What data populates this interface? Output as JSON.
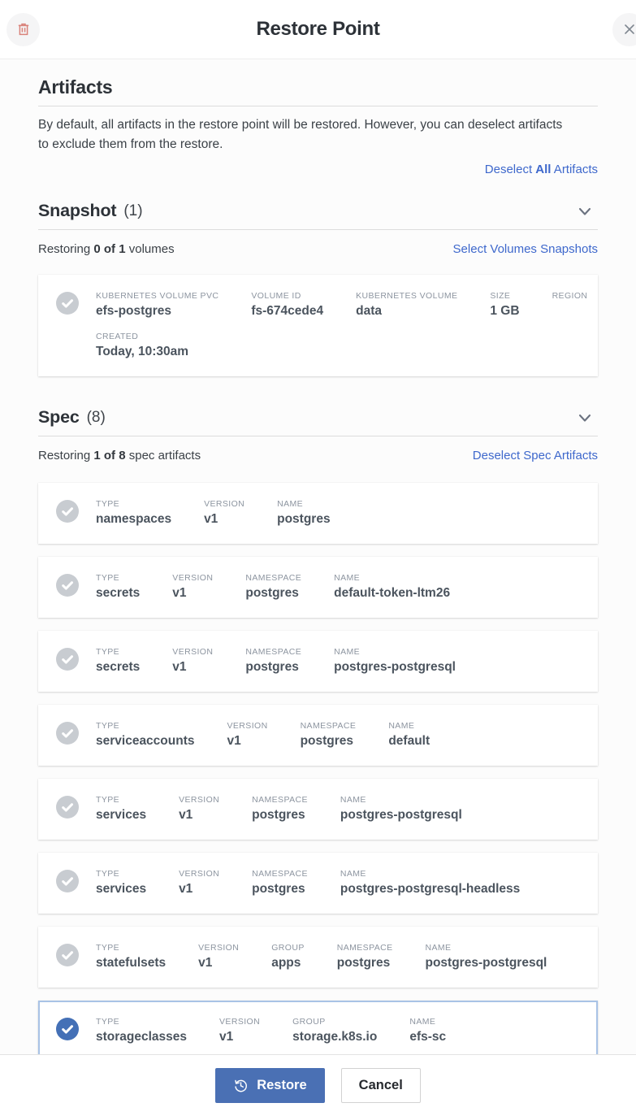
{
  "header": {
    "title": "Restore Point"
  },
  "artifacts": {
    "heading": "Artifacts",
    "description": "By default, all artifacts in the restore point will be restored. However, you can deselect artifacts to exclude them from the restore.",
    "deselect_link": {
      "pre": "Deselect ",
      "bold": "All",
      "post": " Artifacts"
    }
  },
  "snapshot": {
    "heading": "Snapshot",
    "count": "(1)",
    "restoring": {
      "pre": "Restoring ",
      "bold": "0 of 1",
      "post": " volumes"
    },
    "action_link": "Select Volumes Snapshots",
    "card": {
      "selected": false,
      "rows": [
        [
          {
            "label": "KUBERNETES VOLUME PVC",
            "value": "efs-postgres"
          },
          {
            "label": "VOLUME ID",
            "value": "fs-674cede4"
          },
          {
            "label": "KUBERNETES VOLUME",
            "value": "data"
          },
          {
            "label": "SIZE",
            "value": "1 GB"
          },
          {
            "label": "REGION",
            "value": ""
          }
        ],
        [
          {
            "label": "CREATED",
            "value": "Today, 10:30am"
          }
        ]
      ]
    }
  },
  "spec": {
    "heading": "Spec",
    "count": "(8)",
    "restoring": {
      "pre": "Restoring ",
      "bold": "1 of 8",
      "post": " spec artifacts"
    },
    "action_link": "Deselect Spec Artifacts",
    "cards": [
      {
        "selected": false,
        "fields": [
          {
            "label": "TYPE",
            "value": "namespaces"
          },
          {
            "label": "VERSION",
            "value": "v1"
          },
          {
            "label": "NAME",
            "value": "postgres"
          }
        ]
      },
      {
        "selected": false,
        "fields": [
          {
            "label": "TYPE",
            "value": "secrets"
          },
          {
            "label": "VERSION",
            "value": "v1"
          },
          {
            "label": "NAMESPACE",
            "value": "postgres"
          },
          {
            "label": "NAME",
            "value": "default-token-ltm26"
          }
        ]
      },
      {
        "selected": false,
        "fields": [
          {
            "label": "TYPE",
            "value": "secrets"
          },
          {
            "label": "VERSION",
            "value": "v1"
          },
          {
            "label": "NAMESPACE",
            "value": "postgres"
          },
          {
            "label": "NAME",
            "value": "postgres-postgresql"
          }
        ]
      },
      {
        "selected": false,
        "fields": [
          {
            "label": "TYPE",
            "value": "serviceaccounts"
          },
          {
            "label": "VERSION",
            "value": "v1"
          },
          {
            "label": "NAMESPACE",
            "value": "postgres"
          },
          {
            "label": "NAME",
            "value": "default"
          }
        ]
      },
      {
        "selected": false,
        "fields": [
          {
            "label": "TYPE",
            "value": "services"
          },
          {
            "label": "VERSION",
            "value": "v1"
          },
          {
            "label": "NAMESPACE",
            "value": "postgres"
          },
          {
            "label": "NAME",
            "value": "postgres-postgresql"
          }
        ]
      },
      {
        "selected": false,
        "fields": [
          {
            "label": "TYPE",
            "value": "services"
          },
          {
            "label": "VERSION",
            "value": "v1"
          },
          {
            "label": "NAMESPACE",
            "value": "postgres"
          },
          {
            "label": "NAME",
            "value": "postgres-postgresql-headless"
          }
        ]
      },
      {
        "selected": false,
        "fields": [
          {
            "label": "TYPE",
            "value": "statefulsets"
          },
          {
            "label": "VERSION",
            "value": "v1"
          },
          {
            "label": "GROUP",
            "value": "apps"
          },
          {
            "label": "NAMESPACE",
            "value": "postgres"
          },
          {
            "label": "NAME",
            "value": "postgres-postgresql"
          }
        ]
      },
      {
        "selected": true,
        "fields": [
          {
            "label": "TYPE",
            "value": "storageclasses"
          },
          {
            "label": "VERSION",
            "value": "v1"
          },
          {
            "label": "GROUP",
            "value": "storage.k8s.io"
          },
          {
            "label": "NAME",
            "value": "efs-sc"
          }
        ]
      }
    ]
  },
  "footer": {
    "restore_label": "Restore",
    "cancel_label": "Cancel"
  },
  "colors": {
    "accent_blue": "#4a70b4",
    "link_blue": "#3e68cc",
    "check_unselected": "#c8ccd1",
    "check_selected": "#4470b6",
    "selected_card_border": "#a9c3e6",
    "trash_red": "#d9827a"
  }
}
